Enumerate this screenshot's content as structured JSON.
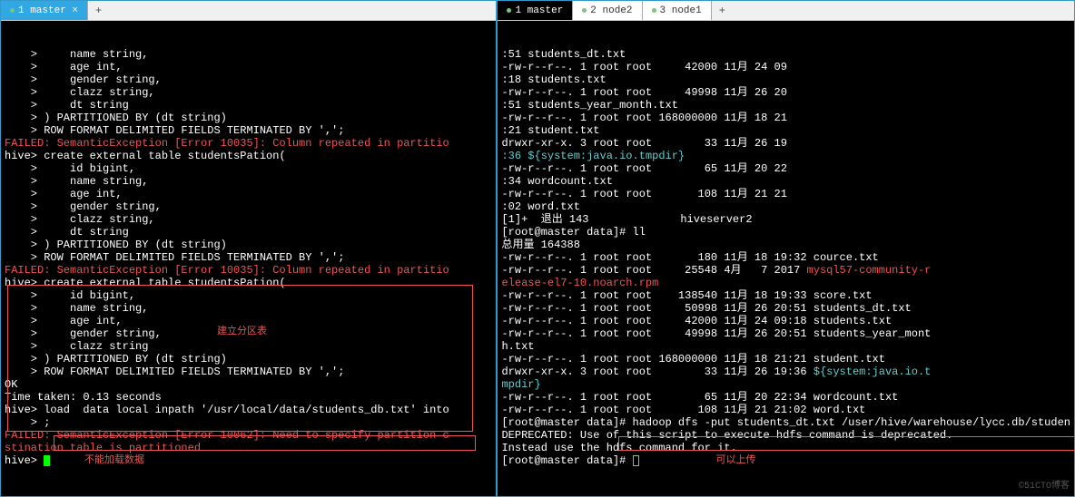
{
  "left": {
    "tabs": [
      {
        "label": "1 master ×",
        "active": true
      }
    ],
    "add": "+",
    "lines": [
      {
        "text": "    >     name string,",
        "cls": ""
      },
      {
        "text": "    >     age int,",
        "cls": ""
      },
      {
        "text": "    >     gender string,",
        "cls": ""
      },
      {
        "text": "    >     clazz string,",
        "cls": ""
      },
      {
        "text": "    >     dt string",
        "cls": ""
      },
      {
        "text": "    > ) PARTITIONED BY (dt string)",
        "cls": ""
      },
      {
        "text": "    > ROW FORMAT DELIMITED FIELDS TERMINATED BY ',';",
        "cls": ""
      },
      {
        "text": "FAILED: SemanticException [Error 10035]: Column repeated in partitio",
        "cls": "red"
      },
      {
        "text": "hive> create external table studentsPation(",
        "cls": ""
      },
      {
        "text": "    >     id bigint,",
        "cls": ""
      },
      {
        "text": "    >     name string,",
        "cls": ""
      },
      {
        "text": "    >     age int,",
        "cls": ""
      },
      {
        "text": "    >     gender string,",
        "cls": ""
      },
      {
        "text": "    >     clazz string,",
        "cls": ""
      },
      {
        "text": "    >     dt string",
        "cls": ""
      },
      {
        "text": "    > ) PARTITIONED BY (dt string)",
        "cls": ""
      },
      {
        "text": "    > ROW FORMAT DELIMITED FIELDS TERMINATED BY ',';",
        "cls": ""
      },
      {
        "text": "FAILED: SemanticException [Error 10035]: Column repeated in partitio",
        "cls": "red"
      },
      {
        "text": "hive> create external table studentsPation(",
        "cls": ""
      },
      {
        "text": "    >     id bigint,",
        "cls": ""
      },
      {
        "text": "    >     name string,",
        "cls": ""
      },
      {
        "text": "    >     age int,",
        "cls": ""
      },
      {
        "text": "    >     gender string,",
        "cls": ""
      },
      {
        "text": "    >     clazz string",
        "cls": ""
      },
      {
        "text": "    > ) PARTITIONED BY (dt string)",
        "cls": ""
      },
      {
        "text": "    > ROW FORMAT DELIMITED FIELDS TERMINATED BY ',';",
        "cls": ""
      },
      {
        "text": "OK",
        "cls": ""
      },
      {
        "text": "Time taken: 0.13 seconds",
        "cls": ""
      },
      {
        "text": "hive> load  data local inpath '/usr/local/data/students_db.txt' into ",
        "cls": ""
      },
      {
        "text": "    > ;",
        "cls": ""
      },
      {
        "text": "",
        "cls": ""
      },
      {
        "text": "FAILED: SemanticException [Error 10062]: Need to specify partition c",
        "cls": "red"
      },
      {
        "text": "stination table is partitioned",
        "cls": "red"
      },
      {
        "text": "hive> ",
        "cls": "",
        "cursor": true
      }
    ],
    "annot1": "建立分区表",
    "annot2": "不能加载数据"
  },
  "right": {
    "tabs": [
      {
        "label": "1 master",
        "active": true,
        "black": true
      },
      {
        "label": "2 node2"
      },
      {
        "label": "3 node1"
      }
    ],
    "add": "+",
    "lines": [
      ":51 students_dt.txt",
      "-rw-r--r--. 1 root root     42000 11月 24 09",
      ":18 students.txt",
      "-rw-r--r--. 1 root root     49998 11月 26 20",
      ":51 students_year_month.txt",
      "-rw-r--r--. 1 root root 168000000 11月 18 21",
      ":21 student.txt",
      "drwxr-xr-x. 3 root root        33 11月 26 19"
    ],
    "tmpdir": ":36 ${system:java.io.tmpdir}",
    "lines2": [
      "-rw-r--r--. 1 root root        65 11月 20 22",
      ":34 wordcount.txt",
      "-rw-r--r--. 1 root root       108 11月 21 21",
      ":02 word.txt",
      "[1]+  退出 143              hiveserver2",
      "[root@master data]# ll",
      "总用量 164388",
      "-rw-r--r--. 1 root root       180 11月 18 19:32 cource.txt"
    ],
    "mysql_line_pre": "-rw-r--r--. 1 root root     25548 4月   7 2017 ",
    "mysql_text": "mysql57-community-r",
    "mysql_text2": "elease-el7-10.noarch.rpm",
    "lines3": [
      "-rw-r--r--. 1 root root    138540 11月 18 19:33 score.txt",
      "-rw-r--r--. 1 root root     50998 11月 26 20:51 students_dt.txt",
      "-rw-r--r--. 1 root root     42000 11月 24 09:18 students.txt",
      "-rw-r--r--. 1 root root     49998 11月 26 20:51 students_year_mont",
      "h.txt",
      "-rw-r--r--. 1 root root 168000000 11月 18 21:21 student.txt"
    ],
    "sys_line_pre": "drwxr-xr-x. 3 root root        33 11月 26 19:36 ",
    "sys_text": "${system:java.io.t",
    "sys_text2": "mpdir}",
    "lines4": [
      "-rw-r--r--. 1 root root        65 11月 20 22:34 wordcount.txt",
      "-rw-r--r--. 1 root root       108 11月 21 21:02 word.txt"
    ],
    "hadoop_pre": "[root@master data]# ",
    "hadoop_cmd": "hadoop dfs -put students_dt.txt /user/hive/warehouse/lycc.db/studen",
    "lines5": [
      "DEPRECATED: Use of this script to execute hdfs command is deprecated.",
      "Instead use the hdfs command for it.",
      "",
      "[root@master data]# "
    ],
    "annot3": "可以上传",
    "watermark": "©51CTO博客"
  }
}
